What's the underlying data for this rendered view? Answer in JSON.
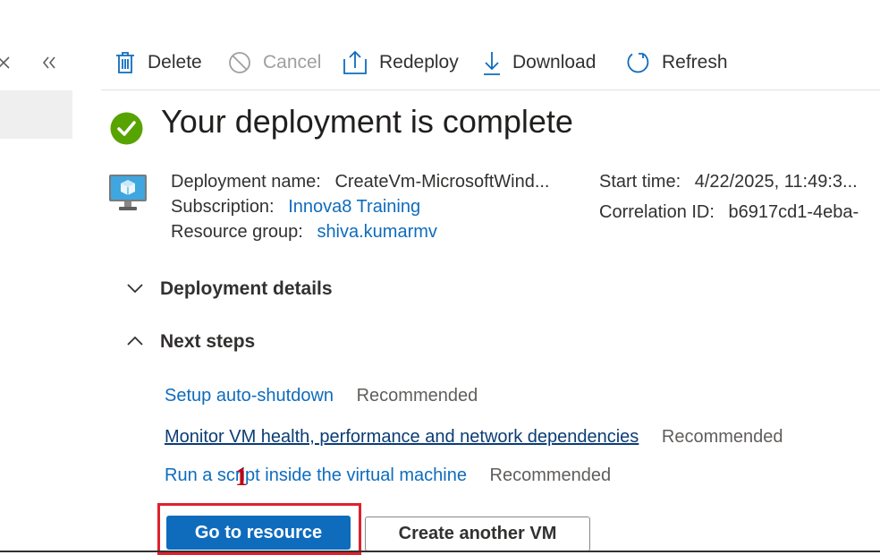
{
  "left_pane": {
    "close_icon": "close-icon",
    "collapse_icon": "double-chevron-left-icon"
  },
  "toolbar": {
    "delete_label": "Delete",
    "cancel_label": "Cancel",
    "redeploy_label": "Redeploy",
    "download_label": "Download",
    "refresh_label": "Refresh"
  },
  "main": {
    "status_icon": "success-check-icon",
    "title": "Your deployment is complete",
    "vm_icon": "virtual-machine-icon",
    "deployment_name_label": "Deployment name:",
    "deployment_name_value": "CreateVm-MicrosoftWind...",
    "subscription_label": "Subscription:",
    "subscription_value": "Innova8 Training",
    "resource_group_label": "Resource group:",
    "resource_group_value": "shiva.kumarmv",
    "start_time_label": "Start time:",
    "start_time_value": "4/22/2025, 11:49:3...",
    "correlation_label": "Correlation ID:",
    "correlation_value": "b6917cd1-4eba-"
  },
  "sections": {
    "deployment_details": "Deployment details",
    "next_steps": "Next steps"
  },
  "next_steps": [
    {
      "link": "Setup auto-shutdown",
      "tag": "Recommended"
    },
    {
      "link": "Monitor VM health, performance and network dependencies",
      "tag": "Recommended"
    },
    {
      "link": "Run a script inside the virtual machine",
      "tag": "Recommended"
    }
  ],
  "buttons": {
    "go_to_resource": "Go to resource",
    "create_another_vm": "Create another VM"
  },
  "annotation": {
    "marker": "1",
    "highlight_color": "#e0202e"
  },
  "colors": {
    "accent": "#0f6cbd",
    "success": "#57a300"
  }
}
